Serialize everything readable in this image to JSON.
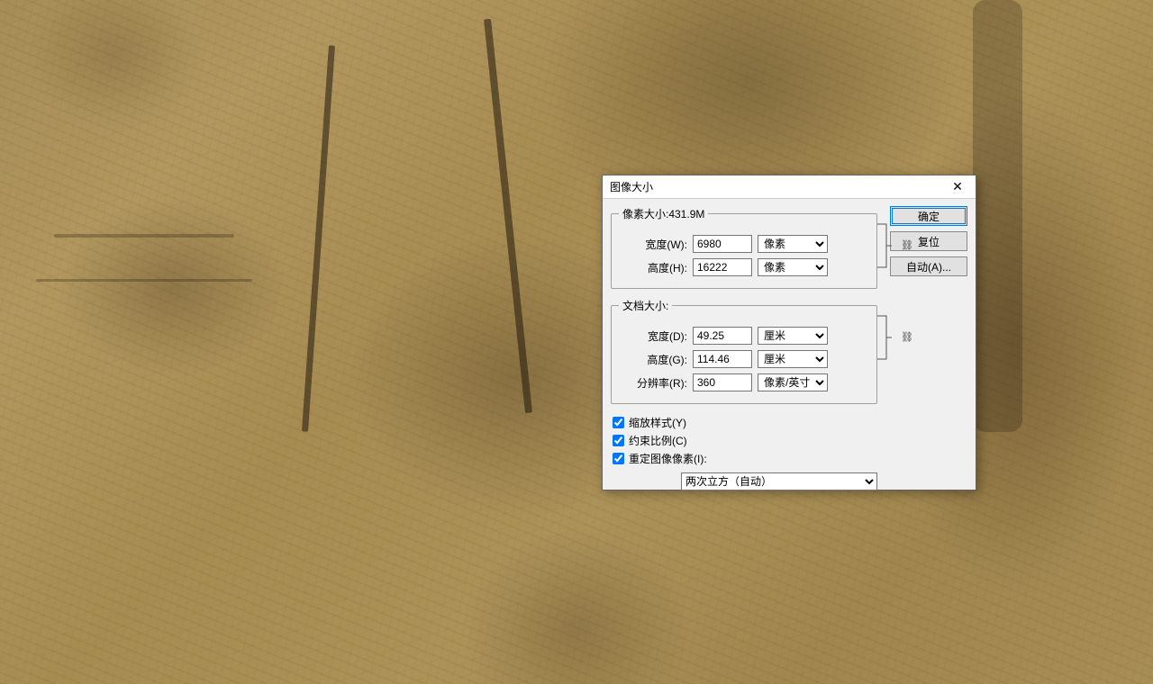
{
  "dialog": {
    "title": "图像大小",
    "close_glyph": "✕",
    "pixel_group": {
      "legend": "像素大小:431.9M",
      "width_label": "宽度(W):",
      "width_value": "6980",
      "width_unit": "像素",
      "height_label": "高度(H):",
      "height_value": "16222",
      "height_unit": "像素"
    },
    "doc_group": {
      "legend": "文档大小:",
      "width_label": "宽度(D):",
      "width_value": "49.25",
      "width_unit": "厘米",
      "height_label": "高度(G):",
      "height_value": "114.46",
      "height_unit": "厘米",
      "res_label": "分辨率(R):",
      "res_value": "360",
      "res_unit": "像素/英寸"
    },
    "checks": {
      "scale_styles": "缩放样式(Y)",
      "constrain": "约束比例(C)",
      "resample": "重定图像像素(I):"
    },
    "resample_method": "两次立方（自动）",
    "buttons": {
      "ok": "确定",
      "reset": "复位",
      "auto": "自动(A)..."
    }
  },
  "icons": {
    "link": "⛓"
  }
}
